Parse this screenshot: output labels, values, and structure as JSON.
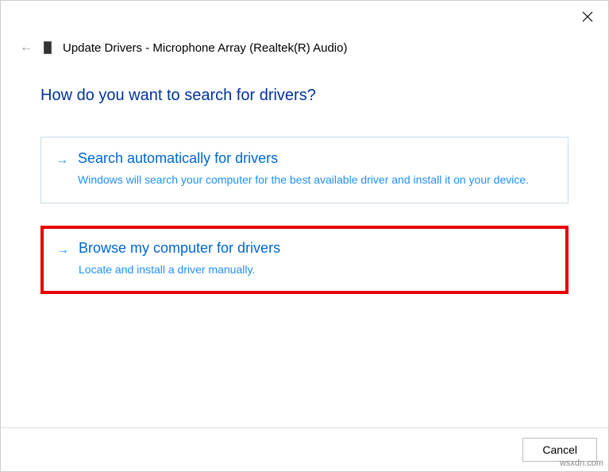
{
  "window": {
    "title": "Update Drivers - Microphone Array (Realtek(R) Audio)"
  },
  "heading": "How do you want to search for drivers?",
  "options": [
    {
      "title": "Search automatically for drivers",
      "description": "Windows will search your computer for the best available driver and install it on your device."
    },
    {
      "title": "Browse my computer for drivers",
      "description": "Locate and install a driver manually."
    }
  ],
  "buttons": {
    "cancel": "Cancel"
  },
  "watermark": "wsxdn.com"
}
